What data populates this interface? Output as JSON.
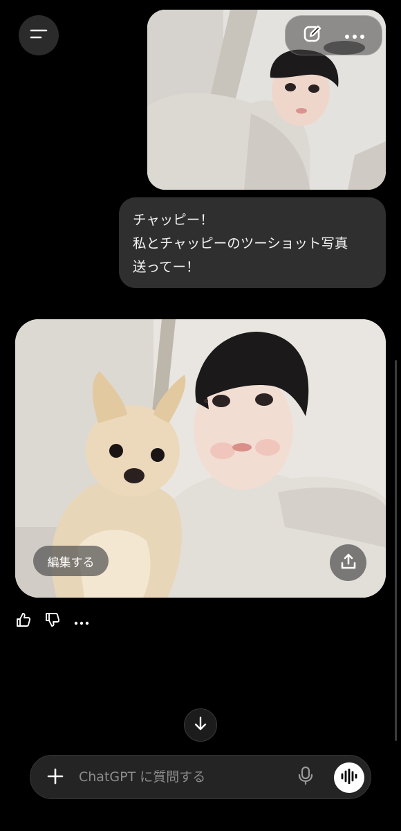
{
  "header": {
    "menu_icon": "menu-icon",
    "edit_icon": "edit-icon",
    "more_icon": "more-icon"
  },
  "conversation": {
    "user_photo": {
      "description_icon": "image"
    },
    "user_message": {
      "lines": [
        "チャッピー！",
        "私とチャッピーのツーショット写真",
        "送ってー！"
      ]
    },
    "ai_photo": {
      "edit_label": "編集する",
      "share_icon": "share-icon"
    },
    "feedback": {
      "thumbs_up_icon": "thumbs-up-icon",
      "thumbs_down_icon": "thumbs-down-icon",
      "more_icon": "more-icon"
    }
  },
  "scroll_down_icon": "arrow-down-icon",
  "composer": {
    "placeholder": "ChatGPT に質問する",
    "value": "",
    "plus_icon": "plus-icon",
    "mic_icon": "mic-icon",
    "voice_icon": "voice-waveform-icon"
  },
  "colors": {
    "background": "#000000",
    "bubble": "#2f2f2f",
    "composer": "#242424"
  }
}
